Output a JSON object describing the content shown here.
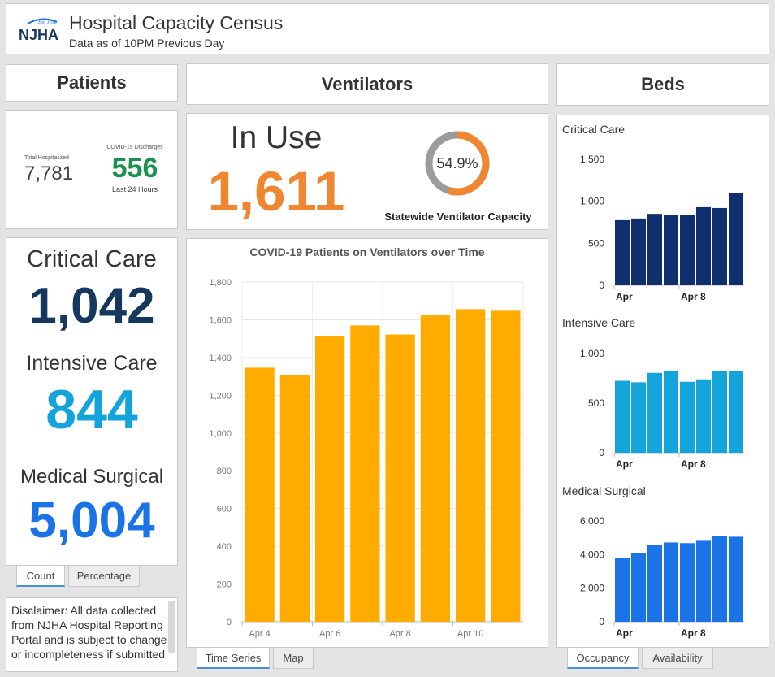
{
  "header": {
    "logo_text": "NJHA",
    "logo_tagline": "Est. 1918",
    "title": "Hospital Capacity Census",
    "subtitle": "Data as of 10PM Previous Day"
  },
  "patients": {
    "section_title": "Patients",
    "total_label": "Total Hospitalized",
    "total_value": "7,781",
    "discharges_label": "COVID-19 Discharges",
    "discharges_value": "556",
    "discharges_period": "Last 24 Hours",
    "critical_label": "Critical Care",
    "critical_value": "1,042",
    "intensive_label": "Intensive Care",
    "intensive_value": "844",
    "medsurg_label": "Medical Surgical",
    "medsurg_value": "5,004",
    "tabs": [
      "Count",
      "Percentage"
    ],
    "disclaimer": "Disclaimer:  All data collected from NJHA Hospital Reporting Portal and is subject to change or incompleteness if submitted"
  },
  "ventilators": {
    "section_title": "Ventilators",
    "in_use_label": "In Use",
    "in_use_value": "1,611",
    "capacity_pct": 54.9,
    "capacity_text": "54.9%",
    "capacity_label": "Statewide Ventilator Capacity",
    "tabs": [
      "Time Series",
      "Map"
    ]
  },
  "beds": {
    "section_title": "Beds",
    "tabs": [
      "Occupancy",
      "Availability"
    ]
  },
  "colors": {
    "orange": "#f0862f",
    "vent_bar": "#ffab00",
    "critical": "#0f2f6e",
    "intensive": "#14a4dc",
    "medsurg": "#1b73e8",
    "discharge_green": "#1a9150",
    "dark_navy": "#15385e",
    "gauge_grey": "#9b9b9b"
  },
  "chart_data": [
    {
      "id": "vent",
      "type": "bar",
      "title": "COVID-19 Patients on Ventilators over Time",
      "x_tick_labels": [
        "Apr 4",
        "Apr 6",
        "Apr 8",
        "Apr 10"
      ],
      "x_tick_positions": [
        0,
        2,
        4,
        6
      ],
      "values": [
        1346,
        1308,
        1515,
        1570,
        1522,
        1625,
        1656,
        1648
      ],
      "ylim": [
        0,
        1800
      ],
      "yticks": [
        0,
        200,
        400,
        600,
        800,
        1000,
        1200,
        1400,
        1600,
        1800
      ],
      "ytick_labels": [
        "0",
        "200",
        "400",
        "600",
        "800",
        "1,000",
        "1,200",
        "1,400",
        "1,600",
        "1,800"
      ]
    },
    {
      "id": "critical",
      "type": "bar",
      "title": "Critical Care",
      "x_tick_labels": [
        "Apr",
        "Apr 8"
      ],
      "values": [
        775,
        795,
        850,
        835,
        835,
        930,
        920,
        1095
      ],
      "ylim": [
        0,
        1500
      ],
      "yticks": [
        0,
        500,
        1000,
        1500
      ],
      "ytick_labels": [
        "0",
        "500",
        "1,000",
        "1,500"
      ]
    },
    {
      "id": "intensive",
      "type": "bar",
      "title": "Intensive Care",
      "x_tick_labels": [
        "Apr",
        "Apr 8"
      ],
      "values": [
        725,
        710,
        805,
        820,
        715,
        740,
        820,
        820
      ],
      "ylim": [
        0,
        1000
      ],
      "yticks": [
        0,
        500,
        1000
      ],
      "ytick_labels": [
        "0",
        "500",
        "1,000"
      ]
    },
    {
      "id": "medsurg",
      "type": "bar",
      "title": "Medical Surgical",
      "x_tick_labels": [
        "Apr",
        "Apr 8"
      ],
      "values": [
        3820,
        4080,
        4570,
        4720,
        4680,
        4820,
        5100,
        5060
      ],
      "ylim": [
        0,
        6000
      ],
      "yticks": [
        0,
        2000,
        4000,
        6000
      ],
      "ytick_labels": [
        "0",
        "2,000",
        "4,000",
        "6,000"
      ]
    }
  ]
}
